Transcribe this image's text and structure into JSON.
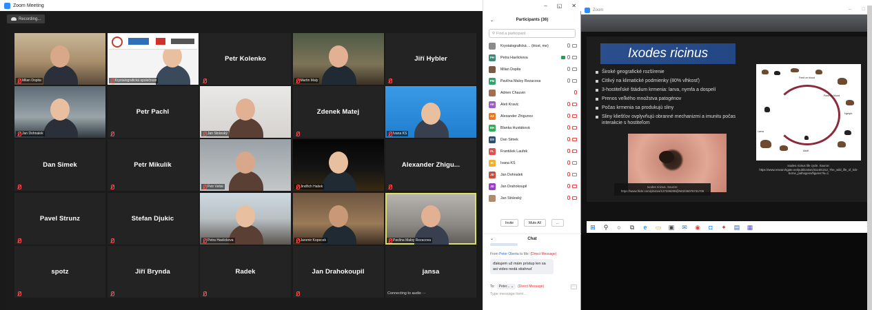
{
  "meeting": {
    "window_title": "Zoom Meeting",
    "recording_label": "Recording...",
    "tiles": [
      {
        "name": "",
        "label": "Milan Dopita",
        "video": "v-office"
      },
      {
        "name": "",
        "label": "Krystalografická společnost",
        "video": "v-logos"
      },
      {
        "name": "Petr Kolenko",
        "label": "",
        "video": ""
      },
      {
        "name": "",
        "label": "Martin Maly",
        "video": "v-room"
      },
      {
        "name": "Jiří Hybler",
        "label": "",
        "video": ""
      },
      {
        "name": "",
        "label": "Jan Dohnalek",
        "video": "v-blue"
      },
      {
        "name": "Petr Pachl",
        "label": "",
        "video": ""
      },
      {
        "name": "",
        "label": "Jan Stránský",
        "video": "v-white"
      },
      {
        "name": "Zdenek Matej",
        "label": "",
        "video": ""
      },
      {
        "name": "",
        "label": "Ivana KS",
        "video": "v-azure"
      },
      {
        "name": "Dan Simek",
        "label": "",
        "video": ""
      },
      {
        "name": "Petr Mikulík",
        "label": "",
        "video": ""
      },
      {
        "name": "",
        "label": "Petr Veltál",
        "video": "v-grey"
      },
      {
        "name": "",
        "label": "Jindřich Hašek",
        "video": "v-night"
      },
      {
        "name": "Alexander  Zhigu...",
        "label": "",
        "video": ""
      },
      {
        "name": "Pavel Strunz",
        "label": "",
        "video": ""
      },
      {
        "name": "Stefan Djukic",
        "label": "",
        "video": ""
      },
      {
        "name": "",
        "label": "Petra Havlickova",
        "video": "v-gallery"
      },
      {
        "name": "",
        "label": "Jaromir Kopecek",
        "video": "v-warm"
      },
      {
        "name": "",
        "label": "Pavlína Maloy Rezacova",
        "video": "v-kitchen"
      },
      {
        "name": "spotz",
        "label": "",
        "video": ""
      },
      {
        "name": "Jiří Brynda",
        "label": "",
        "video": ""
      },
      {
        "name": "Radek",
        "label": "",
        "video": ""
      },
      {
        "name": "Jan Drahokoupil",
        "label": "",
        "video": ""
      },
      {
        "name": "jansa",
        "label": "Connecting to audio ···",
        "video": ""
      }
    ]
  },
  "participants": {
    "header": "Participants (36)",
    "search_placeholder": "Find a participant",
    "items": [
      {
        "initials": "",
        "name": "Krystalografická ... (Host, me)",
        "color": "#8b8b8b",
        "mic": "on",
        "cam": "on",
        "share": false
      },
      {
        "initials": "PH",
        "name": "Petra Havlickova",
        "color": "#3b8a7a",
        "mic": "on",
        "cam": "on",
        "share": true
      },
      {
        "initials": "",
        "name": "Milan Dopita",
        "color": "#7a5a40",
        "mic": "on",
        "cam": "on",
        "share": false
      },
      {
        "initials": "PM",
        "name": "Pavlína Maloy Rezacova",
        "color": "#2ea36b",
        "mic": "on",
        "cam": "on",
        "share": false
      },
      {
        "initials": "",
        "name": "Adrien Chauvin",
        "color": "#a07050",
        "mic": "off",
        "cam": "",
        "share": false
      },
      {
        "initials": "AK",
        "name": "Aleš Kravic",
        "color": "#a05ac8",
        "mic": "off",
        "cam": "off",
        "share": false
      },
      {
        "initials": "AZ",
        "name": "Alexander Zhigunov",
        "color": "#e07b2a",
        "mic": "off",
        "cam": "off",
        "share": false
      },
      {
        "initials": "BH",
        "name": "Blanka Hustáková",
        "color": "#2eae5a",
        "mic": "off",
        "cam": "off",
        "share": false
      },
      {
        "initials": "DS",
        "name": "Dan Simek",
        "color": "#2f4f6f",
        "mic": "off",
        "cam": "off",
        "share": false
      },
      {
        "initials": "FL",
        "name": "František Laufek",
        "color": "#e05050",
        "mic": "off",
        "cam": "off",
        "share": false
      },
      {
        "initials": "IK",
        "name": "Ivana KS",
        "color": "#f0b030",
        "mic": "off",
        "cam": "on",
        "share": false
      },
      {
        "initials": "JD",
        "name": "Jan Dohnalek",
        "color": "#d04a3a",
        "mic": "off",
        "cam": "on",
        "share": false
      },
      {
        "initials": "JD",
        "name": "Jan Drahokoupil",
        "color": "#9a3fc4",
        "mic": "off",
        "cam": "off",
        "share": false
      },
      {
        "initials": "",
        "name": "Jan Stránský",
        "color": "#b08a6a",
        "mic": "off",
        "cam": "off",
        "share": false
      }
    ],
    "invite_label": "Invite",
    "mute_all_label": "Mute All",
    "more_label": "..."
  },
  "chat": {
    "header": "Chat",
    "from_prefix": "From",
    "from_name": "Peter Oberta",
    "to_me": "to Me:",
    "direct": "(Direct Message)",
    "message": "ďakujem už mám prístup len sa asi video nedá stiahnuť",
    "to_label": "To:",
    "to_value": "Peter...",
    "to_direct": "(Direct Message)",
    "input_placeholder": "Type message here..."
  },
  "share": {
    "window_title": "Zoom",
    "slide_title": "Ixodes ricinus",
    "bullets": [
      "Široké geografické rozšírenie",
      "Citlivý na klimatické podmienky (80% vlhkosť)",
      "3-hostiteľské štádium krmenia: larva, nymfa a dospelí",
      "Prenos veľkého množstva patogénov",
      "Počas krmenia sa produkujú sliny",
      "Sliny kliešťov ovplyvňujú obranné mechanizmi a imunitu počas interakcie s hostiteľom"
    ],
    "photo_caption": "Ixodes ricinus. Source: https://www.flickr.com/photos/127339209@N02/36076731709",
    "cycle_caption": "Ixodes ricinus life cycle. Source: https://www.researchgate.net/publication/311401312_The_wild_life_of_tick-borne_pathogens/figures?lo=1",
    "cycle_labels": [
      "Larva",
      "Nymph",
      "Adult",
      "Feed on blood",
      "Feed on blood"
    ],
    "taskbar_clock": "26",
    "taskbar_icons": [
      "windows-icon",
      "search-icon",
      "cortana-icon",
      "task-view-icon",
      "edge-icon",
      "explorer-icon",
      "store-icon",
      "mail-icon",
      "chrome-icon",
      "zoom-icon",
      "app-icon",
      "save-icon",
      "teams-icon"
    ]
  },
  "colors": {
    "zoom_blue": "#2d8cff",
    "active_speaker": "#d8e25c",
    "muted_red": "#ff4b4b",
    "slide_title_bg": "#2a4f8c"
  }
}
